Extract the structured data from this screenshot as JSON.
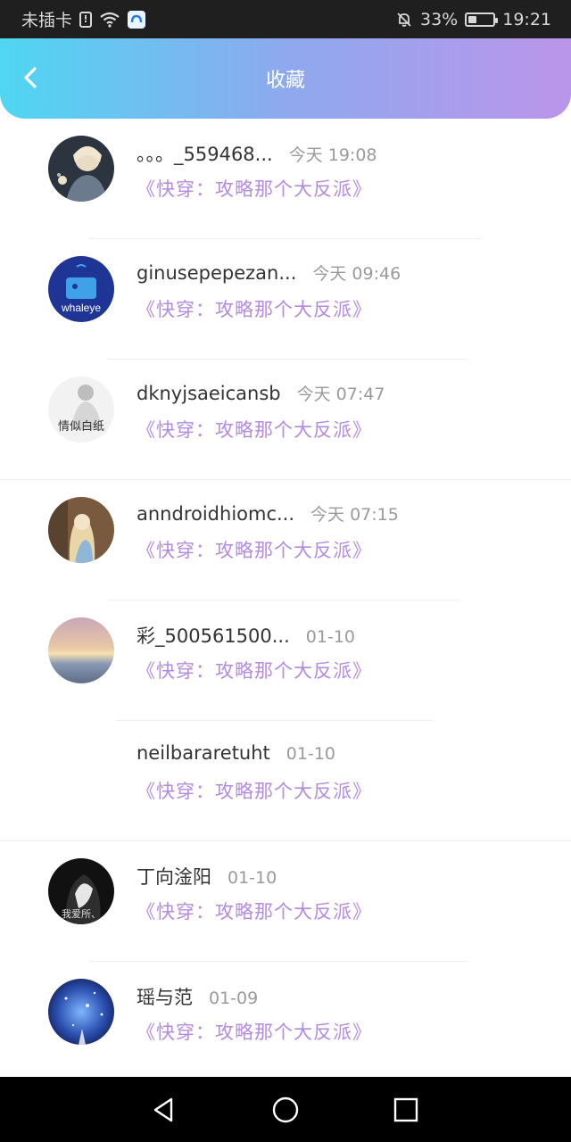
{
  "status_bar": {
    "carrier": "未插卡",
    "battery": "33%",
    "battery_level": 0.33,
    "time": "19:21",
    "icons": [
      "sim-alert-icon",
      "wifi-icon",
      "app-badge-icon",
      "mute-bell-icon",
      "battery-icon"
    ]
  },
  "header": {
    "title": "收藏",
    "back_icon": "chevron-left-icon",
    "gradient": [
      "#4fd6f2",
      "#8ea9ee",
      "#bb95ea"
    ]
  },
  "items": [
    {
      "name": "。。。_559468...",
      "time": "今天 19:08",
      "book": "《快穿：攻略那个大反派》",
      "avatar": "anime-boy"
    },
    {
      "name": "ginusepepezan...",
      "time": "今天 09:46",
      "book": "《快穿：攻略那个大反派》",
      "avatar": "whaley-logo",
      "avatar_text": "whaleye"
    },
    {
      "name": "dknyjsaeicansb",
      "time": "今天 07:47",
      "book": "《快穿：攻略那个大反派》",
      "avatar": "sketch-figure",
      "avatar_text": "情似白纸"
    },
    {
      "name": "anndroidhiomc...",
      "time": "今天 07:15",
      "book": "《快穿：攻略那个大反派》",
      "avatar": "blonde-girl"
    },
    {
      "name": "彩_500561500...",
      "time": "01-10",
      "book": "《快穿：攻略那个大反派》",
      "avatar": "sunset-sky"
    },
    {
      "name": "neilbararetuht",
      "time": "01-10",
      "book": "《快穿：攻略那个大反派》",
      "avatar": "none"
    },
    {
      "name": "丁向淦阳",
      "time": "01-10",
      "book": "《快穿：攻略那个大反派》",
      "avatar": "dark-girl",
      "avatar_text": "我爱所、"
    },
    {
      "name": "瑶与范",
      "time": "01-09",
      "book": "《快穿：攻略那个大反派》",
      "avatar": "starry-night"
    }
  ],
  "nav": {
    "icons": [
      "back-triangle-icon",
      "home-circle-icon",
      "recents-square-icon"
    ]
  },
  "colors": {
    "accent": "#b48be0",
    "name": "#333333",
    "time": "#9a9a9a"
  }
}
